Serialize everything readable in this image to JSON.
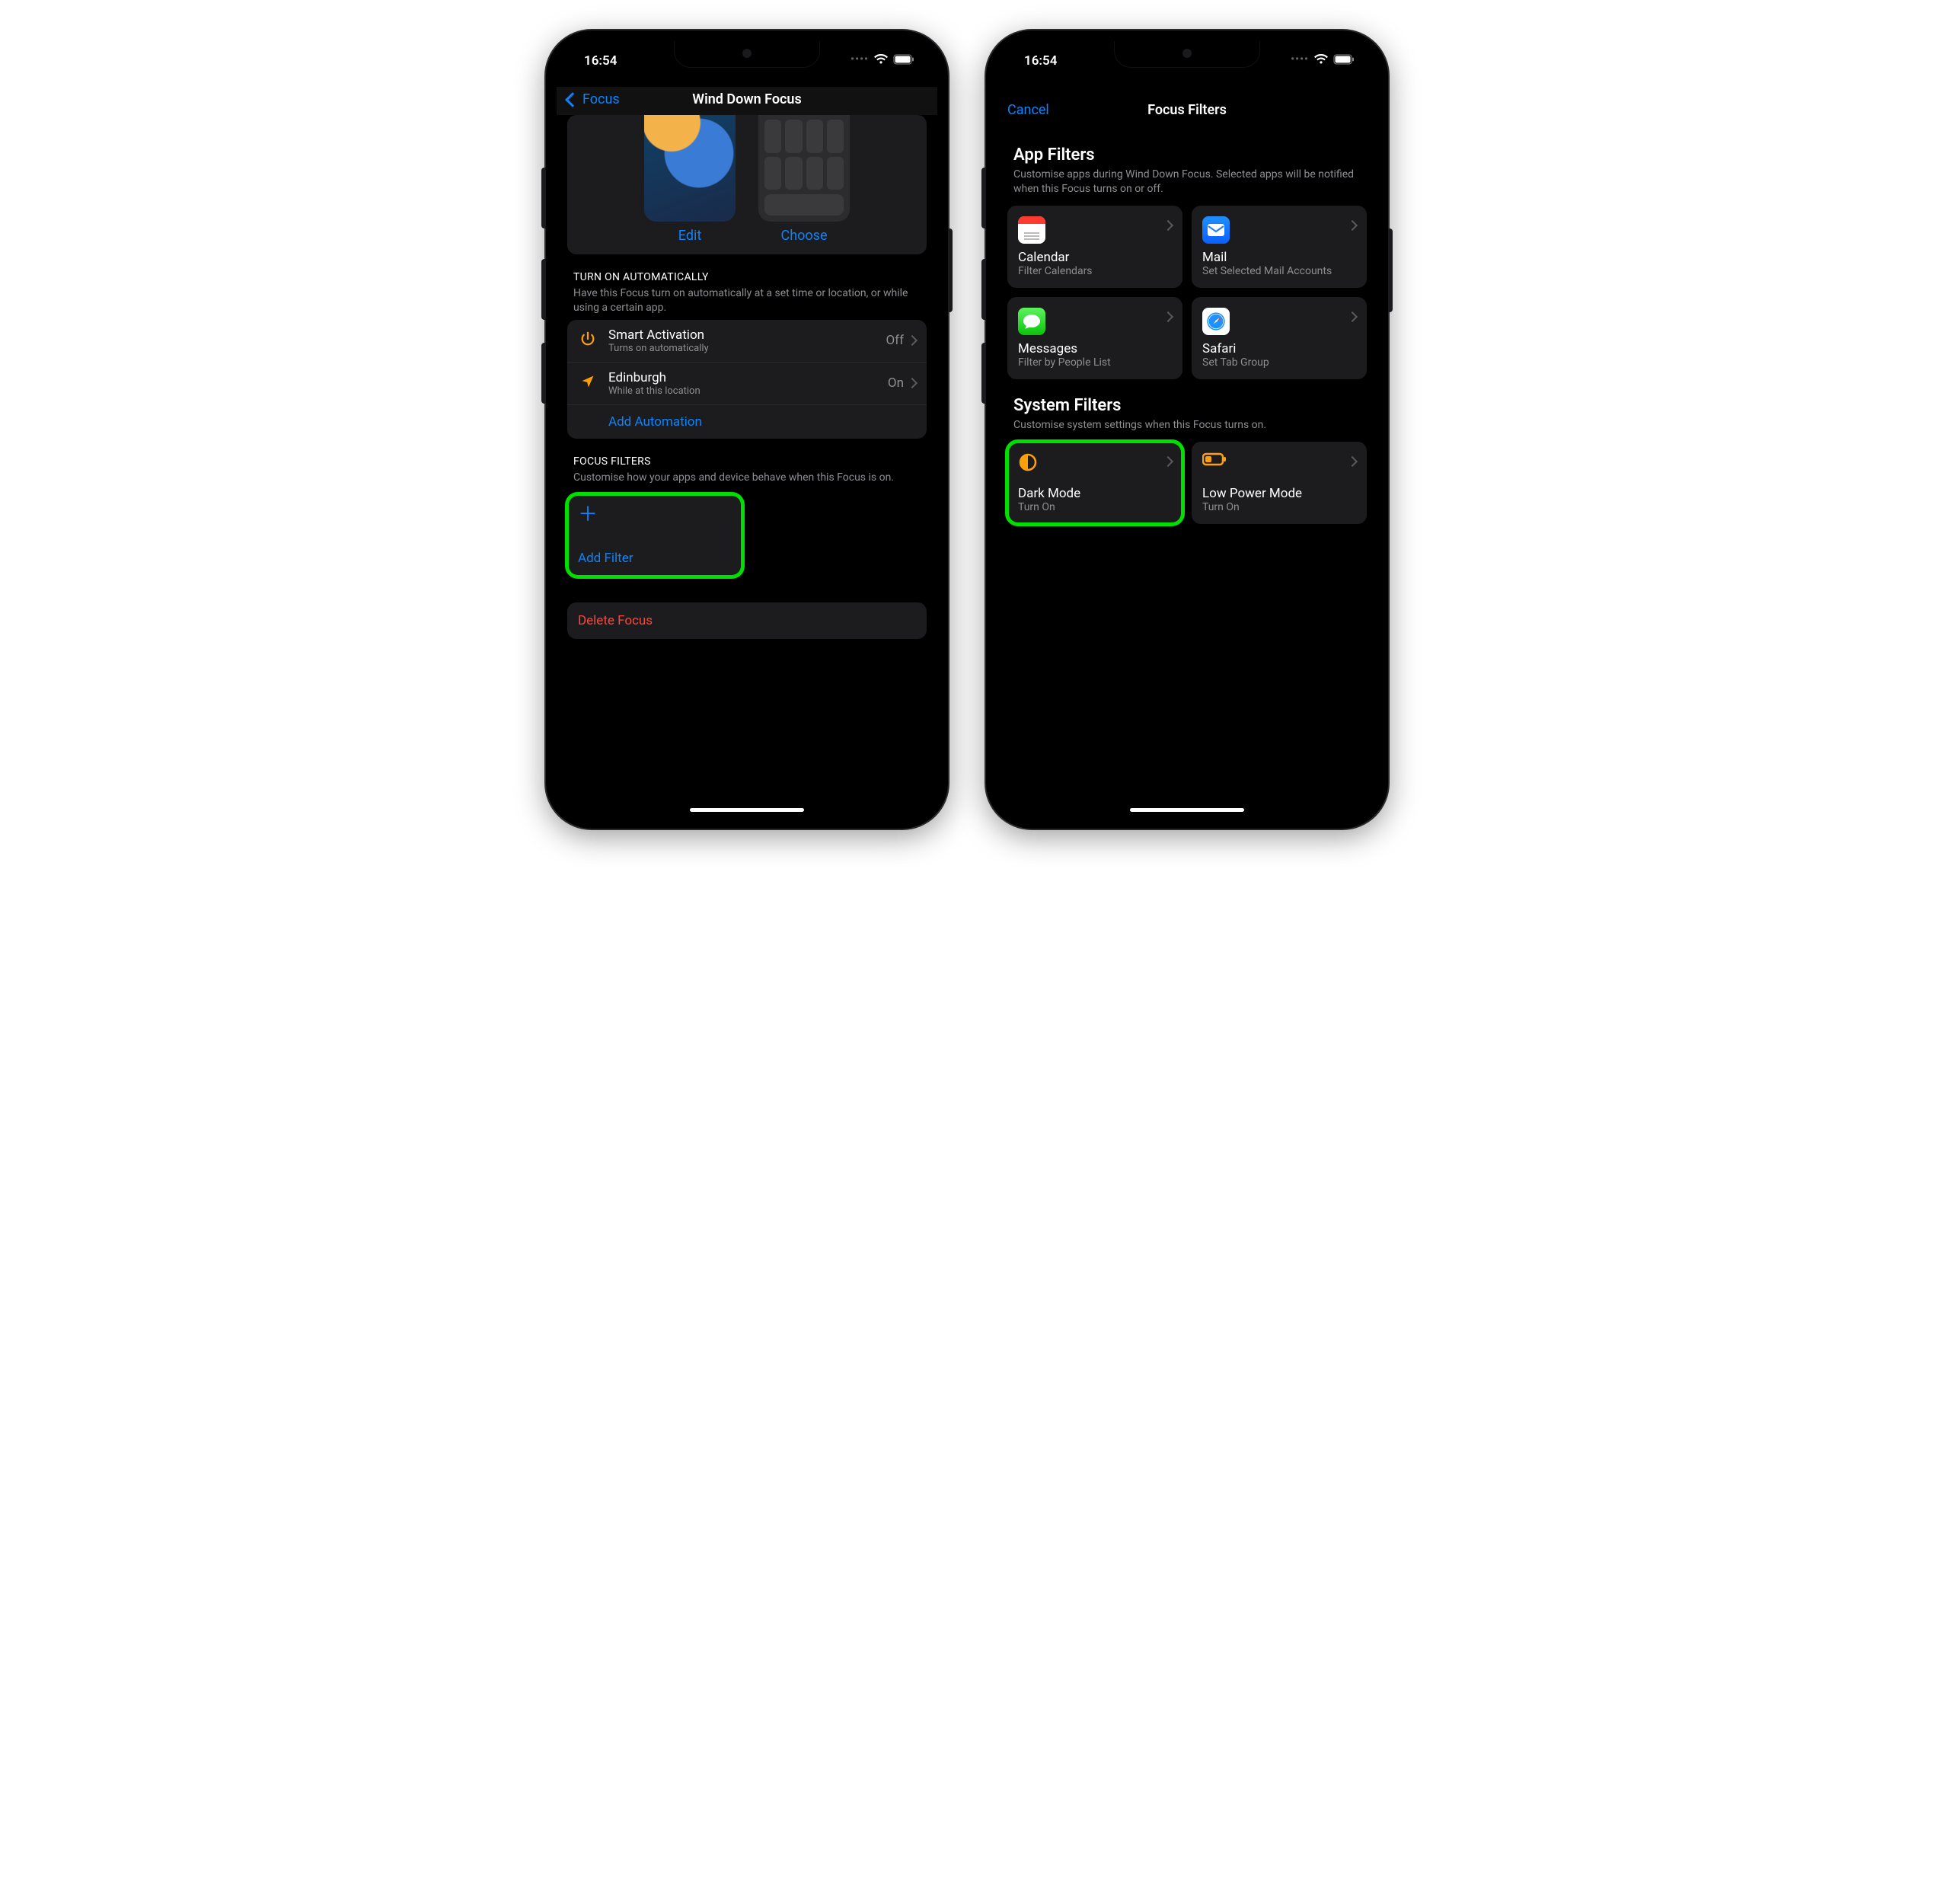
{
  "status": {
    "time": "16:54"
  },
  "left": {
    "nav_back": "Focus",
    "nav_title": "Wind Down Focus",
    "edit": "Edit",
    "choose": "Choose",
    "auto_section_title": "TURN ON AUTOMATICALLY",
    "auto_section_desc": "Have this Focus turn on automatically at a set time or location, or while using a certain app.",
    "rows": [
      {
        "title": "Smart Activation",
        "sub": "Turns on automatically",
        "value": "Off"
      },
      {
        "title": "Edinburgh",
        "sub": "While at this location",
        "value": "On"
      }
    ],
    "add_automation": "Add Automation",
    "filters_title": "FOCUS FILTERS",
    "filters_desc": "Customise how your apps and device behave when this Focus is on.",
    "add_filter": "Add Filter",
    "delete": "Delete Focus"
  },
  "right": {
    "cancel": "Cancel",
    "nav_title": "Focus Filters",
    "app_filters_title": "App Filters",
    "app_filters_desc": "Customise apps during Wind Down Focus. Selected apps will be notified when this Focus turns on or off.",
    "apps": [
      {
        "name": "Calendar",
        "sub": "Filter Calendars"
      },
      {
        "name": "Mail",
        "sub": "Set Selected Mail Accounts"
      },
      {
        "name": "Messages",
        "sub": "Filter by People List"
      },
      {
        "name": "Safari",
        "sub": "Set Tab Group"
      }
    ],
    "sys_title": "System Filters",
    "sys_desc": "Customise system settings when this Focus turns on.",
    "sys": [
      {
        "name": "Dark Mode",
        "sub": "Turn On"
      },
      {
        "name": "Low Power Mode",
        "sub": "Turn On"
      }
    ]
  }
}
